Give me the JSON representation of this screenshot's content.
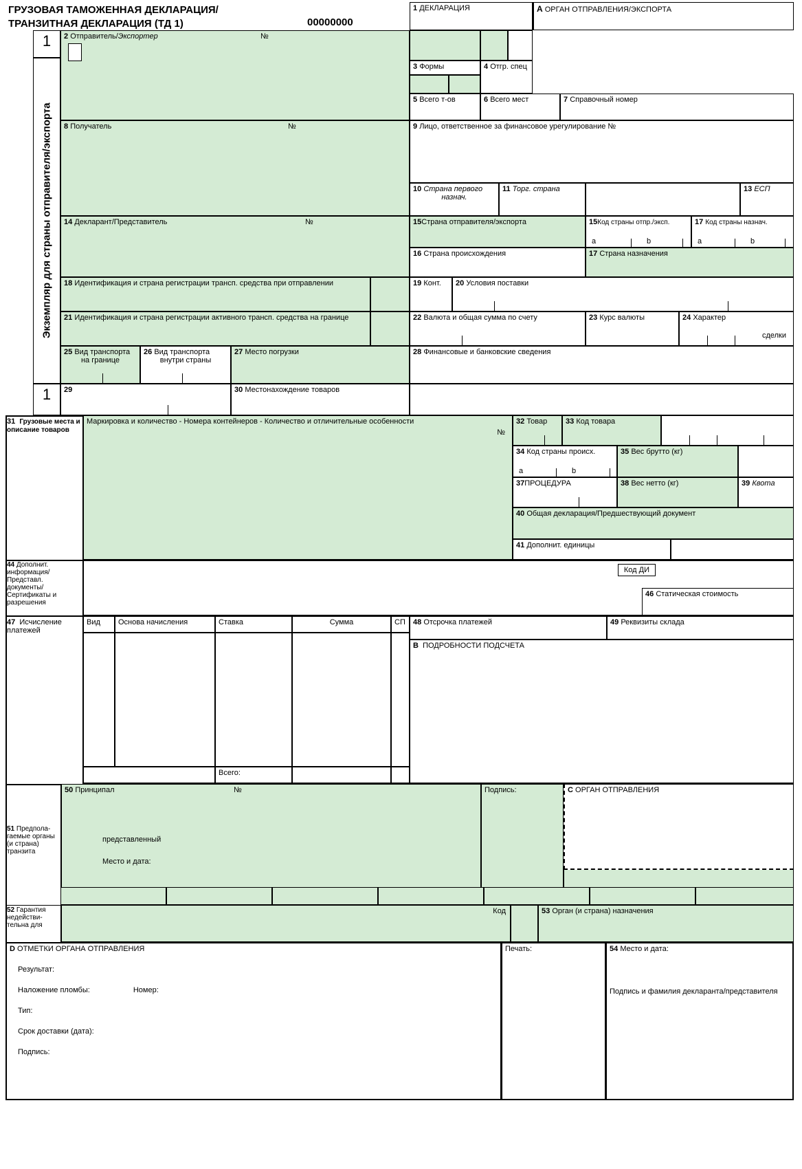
{
  "header": {
    "title_line1": "ГРУЗОВАЯ ТАМОЖЕННАЯ ДЕКЛАРАЦИЯ/",
    "title_line2": "ТРАНЗИТНАЯ ДЕКЛАРАЦИЯ (ТД 1)",
    "number": "00000000",
    "boxA": "ОРГАН ОТПРАВЛЕНИЯ/ЭКСПОРТА",
    "A": "A"
  },
  "copy_num_top": "1",
  "copy_num_mid": "1",
  "side_label": "Экземпляр для страны отправителя/экспорта",
  "f1": {
    "num": "1",
    "label": "ДЕКЛАРАЦИЯ"
  },
  "f2": {
    "num": "2",
    "label": "Отправитель/",
    "label2": "Экспортер",
    "no": "№"
  },
  "f3": {
    "num": "3",
    "label": "Формы"
  },
  "f4": {
    "num": "4",
    "label": "Отгр. спец"
  },
  "f5": {
    "num": "5",
    "label": "Всего т-ов"
  },
  "f6": {
    "num": "6",
    "label": "Всего мест"
  },
  "f7": {
    "num": "7",
    "label": "Справочный номер"
  },
  "f8": {
    "num": "8",
    "label": "Получатель",
    "no": "№"
  },
  "f9": {
    "num": "9",
    "label": "Лицо, ответственное за финансовое урегулирование №"
  },
  "f10": {
    "num": "10",
    "label": "Страна первого",
    "label2": "назнач."
  },
  "f11": {
    "num": "11",
    "label": "Торг. страна"
  },
  "f13": {
    "num": "13",
    "label": "ЕСП"
  },
  "f14": {
    "num": "14",
    "label": "Декларант/Представитель",
    "no": "№"
  },
  "f15": {
    "num": "15",
    "label": "Страна отправителя/экспорта"
  },
  "f15a": {
    "num": "15",
    "label": "Код страны отпр./эксп.",
    "a": "a",
    "b": "b"
  },
  "f16": {
    "num": "16",
    "label": "Страна происхождения"
  },
  "f17a": {
    "num": "17",
    "label": "Код страны назнач.",
    "a": "a",
    "b": "b"
  },
  "f17": {
    "num": "17",
    "label": "Страна назначения"
  },
  "f18": {
    "num": "18",
    "label": "Идентификация и страна регистрации трансп. средства при отправлении"
  },
  "f19": {
    "num": "19",
    "label": "Конт."
  },
  "f20": {
    "num": "20",
    "label": "Условия поставки"
  },
  "f21": {
    "num": "21",
    "label": "Идентификация и страна регистрации активного трансп. средства на границе"
  },
  "f22": {
    "num": "22",
    "label": "Валюта и общая сумма по счету"
  },
  "f23": {
    "num": "23",
    "label": "Курс валюты"
  },
  "f24": {
    "num": "24",
    "label": "Характер",
    "label2": "сделки"
  },
  "f25": {
    "num": "25",
    "label": "Вид транспорта",
    "label2": "на границе"
  },
  "f26": {
    "num": "26",
    "label": "Вид транспорта",
    "label2": "внутри страны"
  },
  "f27": {
    "num": "27",
    "label": "Место погрузки"
  },
  "f28": {
    "num": "28",
    "label": "Финансовые и банковские сведения"
  },
  "f29": {
    "num": "29"
  },
  "f30": {
    "num": "30",
    "label": "Местонахождение товаров"
  },
  "f31": {
    "num": "31",
    "label": "Грузовые места и описание товаров",
    "sub": "Маркировка и количество - Номера контейнеров - Количество и отличительные особенности",
    "no": "№"
  },
  "f32": {
    "num": "32",
    "label": "Товар"
  },
  "f33": {
    "num": "33",
    "label": "Код товара"
  },
  "f34": {
    "num": "34",
    "label": "Код страны происх.",
    "a": "a",
    "b": "b"
  },
  "f35": {
    "num": "35",
    "label": "Вес брутто (кг)"
  },
  "f37": {
    "num": "37",
    "label": "ПРОЦЕДУРА"
  },
  "f38": {
    "num": "38",
    "label": "Вес нетто (кг)"
  },
  "f39": {
    "num": "39",
    "label": "Квота"
  },
  "f40": {
    "num": "40",
    "label": "Общая декларация/Предшествующий документ"
  },
  "f41": {
    "num": "41",
    "label": "Дополнит. единицы"
  },
  "f44": {
    "num": "44",
    "label": "Дополнит. информация/ Представл. документы/ Сертификаты и разрешения",
    "kod": "Код ДИ"
  },
  "f46": {
    "num": "46",
    "label": "Статическая стоимость"
  },
  "f47": {
    "num": "47",
    "label": "Исчисление платежей",
    "cols": {
      "vid": "Вид",
      "osn": "Основа начисления",
      "stavka": "Ставка",
      "summa": "Сумма",
      "sp": "СП"
    },
    "total": "Всего:"
  },
  "f48": {
    "num": "48",
    "label": "Отсрочка платежей"
  },
  "f49": {
    "num": "49",
    "label": "Реквизиты склада"
  },
  "fB": {
    "B": "B",
    "label": "ПОДРОБНОСТИ ПОДСЧЕТА"
  },
  "f50": {
    "num": "50",
    "label": "Принципал",
    "no": "№",
    "pred": "представленный",
    "mesto": "Место и дата:",
    "podpis": "Подпись:"
  },
  "fC": {
    "C": "C",
    "label": "ОРГАН ОТПРАВЛЕНИЯ"
  },
  "f51": {
    "num": "51",
    "label": "Предпола-гаемые органы (и страна) транзита"
  },
  "f52": {
    "num": "52",
    "label": "Гарантия недействи-тельна для",
    "kod": "Код"
  },
  "f53": {
    "num": "53",
    "label": "Орган (и страна) назначения"
  },
  "fD": {
    "D": "D",
    "label": "ОТМЕТКИ ОРГАНА ОТПРАВЛЕНИЯ",
    "result": "Результат:",
    "plomba": "Наложение пломбы:",
    "nomer": "Номер:",
    "tip": "Тип:",
    "srok": "Срок доставки (дата):",
    "podpis": "Подпись:",
    "pechat": "Печать:"
  },
  "f54": {
    "num": "54",
    "label": "Место и дата:",
    "sign": "Подпись и фамилия декларанта/представителя"
  }
}
